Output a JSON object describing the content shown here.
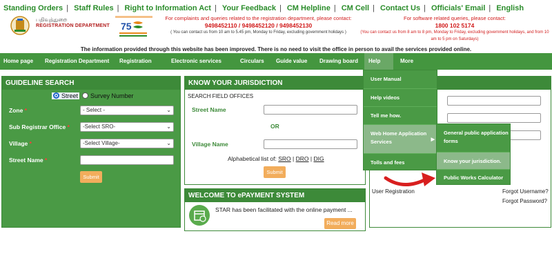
{
  "toplinks": [
    "Standing Orders",
    "Staff Rules",
    "Right to Information Act",
    "Your Feedback",
    "CM Helpline",
    "CM Cell",
    "Contact Us",
    "Officials' Email",
    "English"
  ],
  "header": {
    "dept_tamil": "பதிவுத்துறை",
    "dept_name": "REGISTRATION DEPARTMENT",
    "complaint_line": "For complaints and queries related to the registration department, please contact:",
    "complaint_phones": "9498452110 / 9498452120 / 9498452130",
    "complaint_note": "( You can contact us from 10 am to 5.45 pm, Monday to Friday, excluding government holidays )",
    "software_line": "For software related queries, please contact:",
    "software_phone": "1800 102 5174",
    "software_note": "(You can contact us from 8 am to 8 pm, Monday to Friday, excluding government holidays, and from 10 am to 5 pm on Saturdays)",
    "info": "The information provided through this website has been improved. There is no need to visit the office in person to avail the services provided online."
  },
  "nav": {
    "home": "Home page",
    "regdept": "Registration Department",
    "registration": "Registration",
    "eservices": "Electronic services",
    "circulars": "Circulars",
    "guide": "Guide value",
    "drawing": "Drawing board",
    "help": "Help",
    "more": "More"
  },
  "guideline": {
    "title": "GUIDELINE SEARCH",
    "radio_street": "Street",
    "radio_survey": "Survey Number",
    "zone_label": "Zone",
    "zone_value": "- Select -",
    "sro_label": "Sub Registrar Office",
    "sro_value": "-Select SRO-",
    "village_label": "Village",
    "village_value": "-Select Village-",
    "street_label": "Street Name",
    "req": "*",
    "submit": "Submit"
  },
  "jurisdiction": {
    "title": "KNOW YOUR JURISDICTION",
    "subtitle": "SEARCH FIELD OFFICES",
    "street_label": "Street Name",
    "or": "OR",
    "village_label": "Village Name",
    "alpha_prefix": "Alphabetical list of:",
    "sro": "SRO",
    "dro": "DRO",
    "dig": "DIG",
    "sep": "|",
    "submit": "Submit"
  },
  "epayment": {
    "title": "WELCOME TO ePAYMENT SYSTEM",
    "text": "STAR has been facilitated with the online payment ...",
    "read_more": "Read more"
  },
  "login": {
    "user_registration": "User Registration",
    "forgot_username": "Forgot Username?",
    "forgot_password": "Forgot Password?"
  },
  "help_menu": [
    "User Manual",
    "Help videos",
    "Tell me how.",
    "Web Home Application Services",
    "Tolls and fees"
  ],
  "submenu": [
    "General public application forms",
    "Know your jurisdiction.",
    "Public Works Calculator"
  ],
  "colors": {
    "green": "#44963f",
    "dark_green": "#3d8a39",
    "orange": "#f2ad5c",
    "red": "#d11a1a"
  }
}
